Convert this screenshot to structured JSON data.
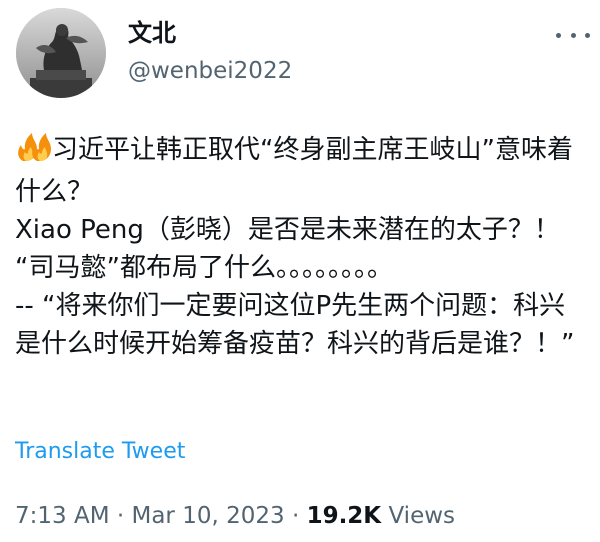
{
  "author": {
    "display_name": "文北",
    "handle": "@wenbei2022"
  },
  "tweet": {
    "emoji": "🔥🔥",
    "text": "习近平让韩正取代“终身副主席王岐山”意味着什么？\nXiao Peng（彭晓）是否是未来潜在的太子？！\n“司马懿”都布局了什么。。。。。。。。\n-- “将来你们一定要问这位P先生两个问题：科兴是什么时候开始筹备疫苗？科兴的背后是谁？！”"
  },
  "translate_label": "Translate Tweet",
  "meta": {
    "time": "7:13 AM",
    "separator": "·",
    "date": "Mar 10, 2023",
    "views_count": "19.2K",
    "views_label": "Views"
  },
  "icons": {
    "more": "more-horizontal-icon",
    "fire": "fire-emoji-icon"
  },
  "colors": {
    "link": "#1d9bf0",
    "secondary": "#536471",
    "text": "#0f1419"
  }
}
